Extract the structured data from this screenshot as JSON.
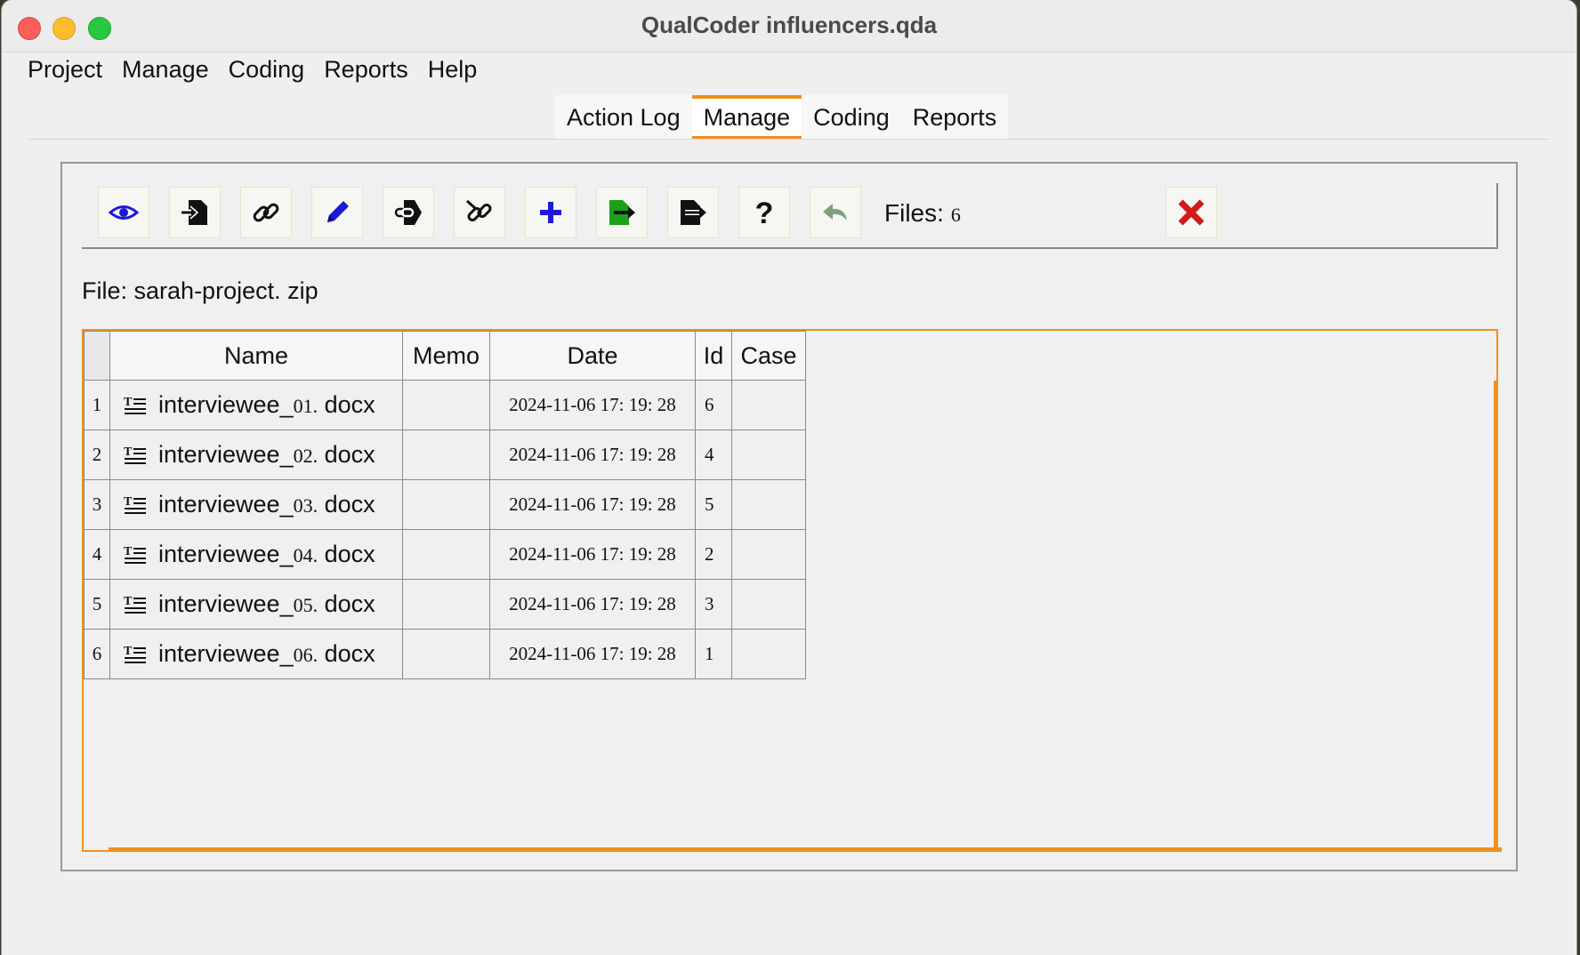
{
  "window": {
    "title": "QualCoder influencers.qda"
  },
  "menubar": [
    "Project",
    "Manage",
    "Coding",
    "Reports",
    "Help"
  ],
  "tabs": [
    {
      "label": "Action Log",
      "active": false
    },
    {
      "label": "Manage",
      "active": true
    },
    {
      "label": "Coding",
      "active": false
    },
    {
      "label": "Reports",
      "active": false
    }
  ],
  "toolbar": {
    "buttons": [
      {
        "icon": "eye-icon"
      },
      {
        "icon": "import-icon"
      },
      {
        "icon": "link-icon"
      },
      {
        "icon": "pencil-icon"
      },
      {
        "icon": "export-link-icon"
      },
      {
        "icon": "unlink-icon"
      },
      {
        "icon": "plus-icon"
      },
      {
        "icon": "export-green-icon"
      },
      {
        "icon": "export-black-icon"
      },
      {
        "icon": "help-icon"
      },
      {
        "icon": "undo-icon"
      }
    ],
    "files_label": "Files:",
    "files_count": "6",
    "close_icon": "close-red-icon"
  },
  "file_line": {
    "label": "File:",
    "name": "sarah-project. zip"
  },
  "table": {
    "columns": [
      "Name",
      "Memo",
      "Date",
      "Id",
      "Case"
    ],
    "rows": [
      {
        "num": "1",
        "name_prefix": "interviewee_",
        "name_num": "01.",
        "name_ext": " docx",
        "memo": "",
        "date": "2024-11-06 17: 19: 28",
        "id": "6",
        "case": ""
      },
      {
        "num": "2",
        "name_prefix": "interviewee_",
        "name_num": "02.",
        "name_ext": " docx",
        "memo": "",
        "date": "2024-11-06 17: 19: 28",
        "id": "4",
        "case": ""
      },
      {
        "num": "3",
        "name_prefix": "interviewee_",
        "name_num": "03.",
        "name_ext": " docx",
        "memo": "",
        "date": "2024-11-06 17: 19: 28",
        "id": "5",
        "case": ""
      },
      {
        "num": "4",
        "name_prefix": "interviewee_",
        "name_num": "04.",
        "name_ext": " docx",
        "memo": "",
        "date": "2024-11-06 17: 19: 28",
        "id": "2",
        "case": ""
      },
      {
        "num": "5",
        "name_prefix": "interviewee_",
        "name_num": "05.",
        "name_ext": " docx",
        "memo": "",
        "date": "2024-11-06 17: 19: 28",
        "id": "3",
        "case": ""
      },
      {
        "num": "6",
        "name_prefix": "interviewee_",
        "name_num": "06.",
        "name_ext": " docx",
        "memo": "",
        "date": "2024-11-06 17: 19: 28",
        "id": "1",
        "case": ""
      }
    ]
  },
  "colors": {
    "accent": "#f0901c",
    "blue_icon": "#1a1ad6",
    "green_icon": "#1aa11a",
    "red_icon": "#d11a1a"
  }
}
